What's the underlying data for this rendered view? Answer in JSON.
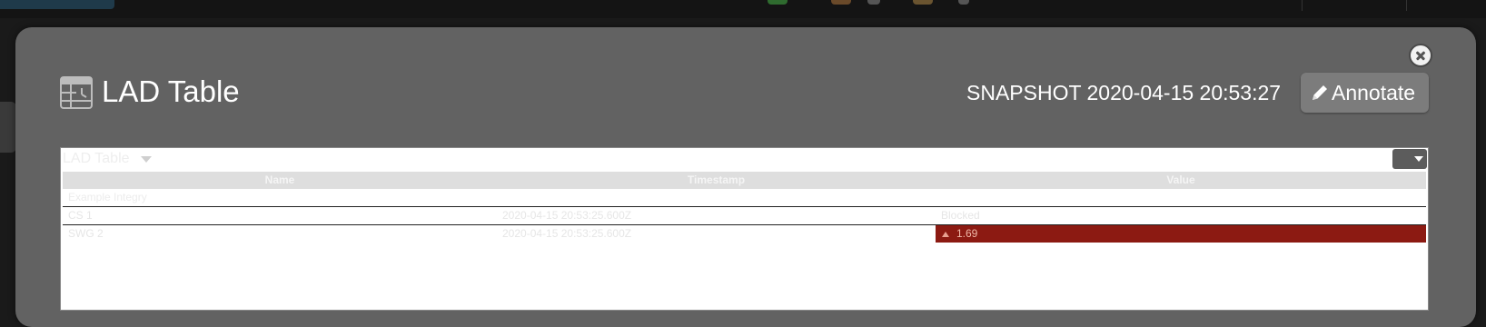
{
  "modal": {
    "title": "LAD Table",
    "snapshot": "SNAPSHOT 2020-04-15 20:53:27",
    "annotate_label": "Annotate",
    "icons": {
      "title": "table-clock-icon",
      "annotate": "pencil-icon",
      "close": "close-circle-icon"
    }
  },
  "panel": {
    "title": "LAD Table",
    "columns": [
      "Name",
      "Timestamp",
      "Value"
    ],
    "group": {
      "name": "Example Integry",
      "timestamp": "",
      "value": ""
    },
    "rows": [
      {
        "name": "CS 1",
        "timestamp": "2020-04-15 20:53:25.600Z",
        "value": "Blocked"
      },
      {
        "name": "SWG 2",
        "timestamp": "2020-04-15 20:53:25.600Z",
        "value": "1.69",
        "status": "alarm-high"
      }
    ]
  },
  "colors": {
    "modal_bg": "#626262",
    "alarm_red": "#8c1a12",
    "button_bg": "#7c7c7c",
    "page_bg": "#1a1a1a"
  }
}
